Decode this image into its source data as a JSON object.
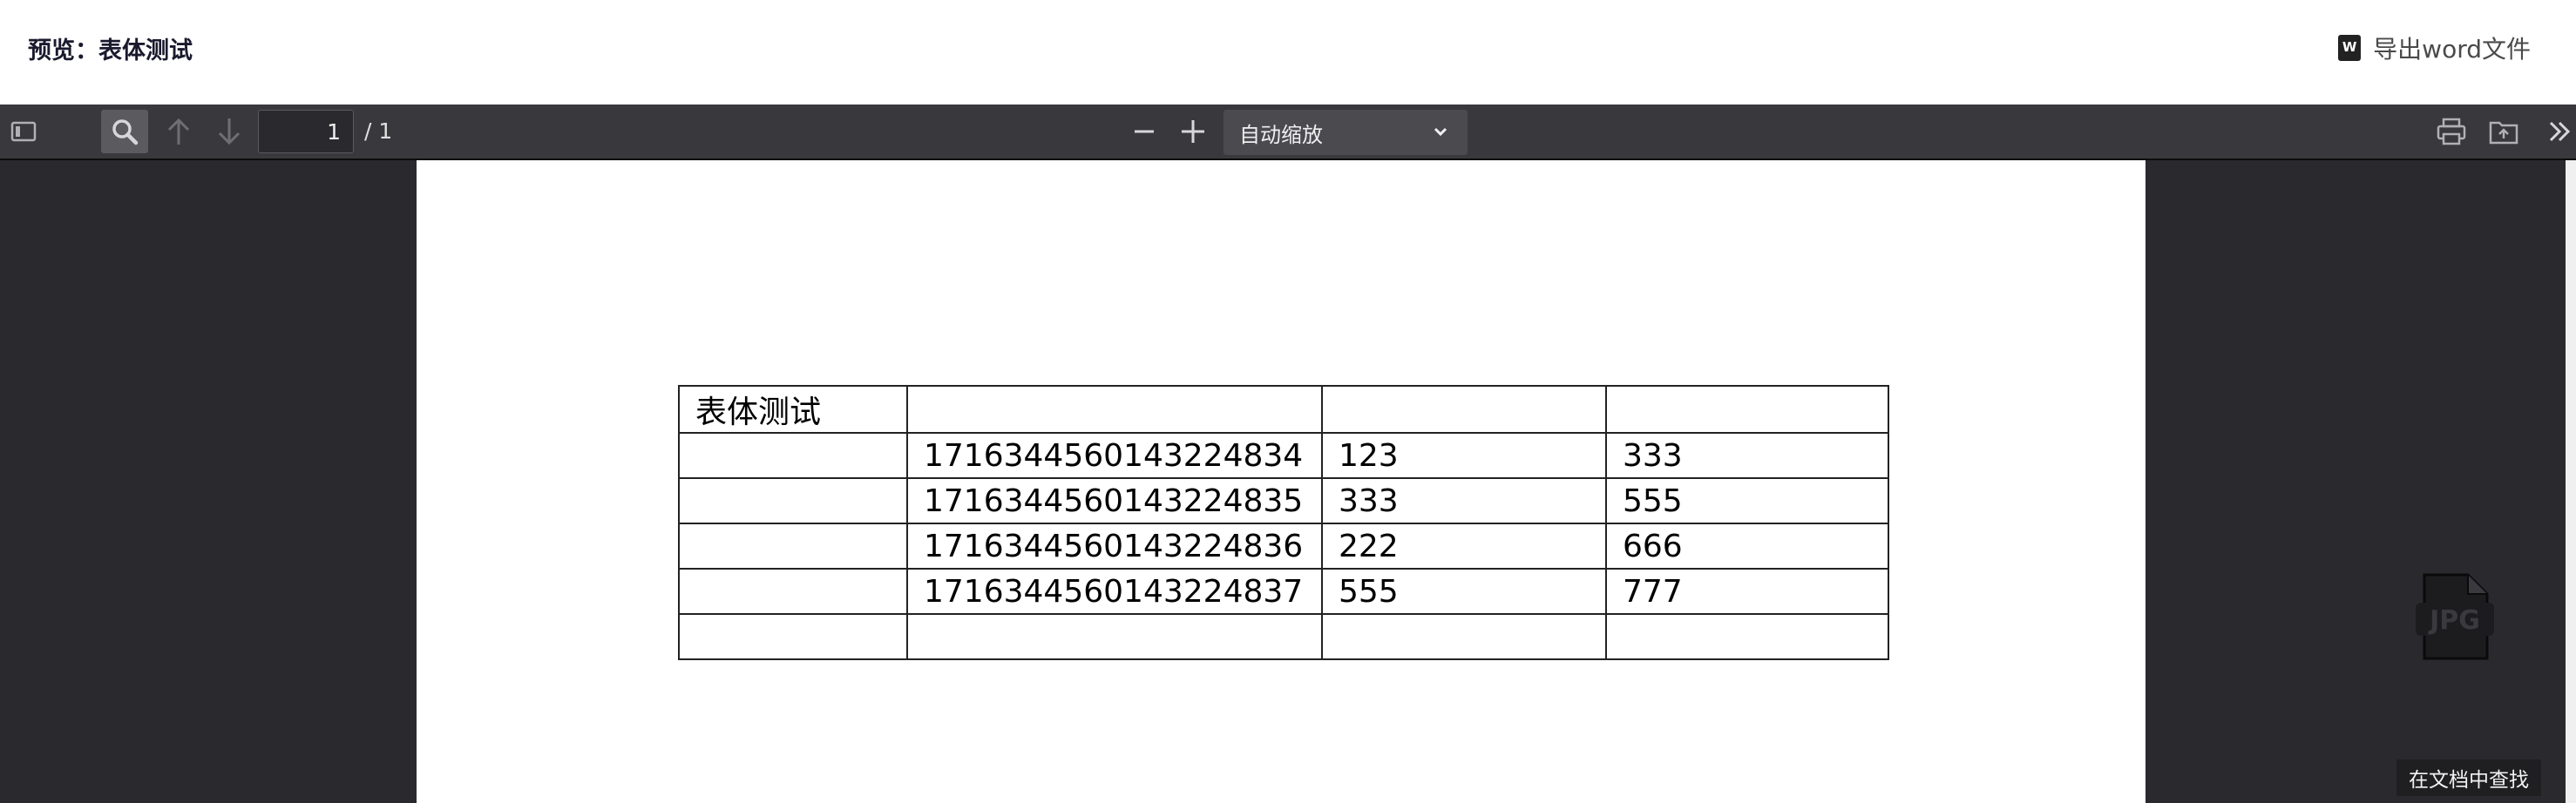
{
  "header": {
    "title": "预览：表体测试",
    "export_label": "导出word文件",
    "export_icon": "word-file-icon"
  },
  "toolbar": {
    "sidebar_icon": "sidebar-toggle-icon",
    "search_icon": "search-icon",
    "prev_icon": "arrow-up-icon",
    "next_icon": "arrow-down-icon",
    "page_number": "1",
    "page_total": "/ 1",
    "zoom_out_icon": "minus-icon",
    "zoom_in_icon": "plus-icon",
    "zoom_value": "自动缩放",
    "print_icon": "print-icon",
    "open_icon": "open-file-icon",
    "tools_icon": "double-chevron-right-icon"
  },
  "document": {
    "table": [
      [
        "表体测试",
        "",
        "",
        ""
      ],
      [
        "",
        "1716344560143224834",
        "123",
        "333"
      ],
      [
        "",
        "1716344560143224835",
        "333",
        "555"
      ],
      [
        "",
        "1716344560143224836",
        "222",
        "666"
      ],
      [
        "",
        "1716344560143224837",
        "555",
        "777"
      ],
      [
        "",
        "",
        "",
        ""
      ]
    ]
  },
  "overlay": {
    "jpg_label": "JPG",
    "find_tooltip": "在文档中查找"
  },
  "colors": {
    "toolbar_bg": "#38383d",
    "viewer_bg": "#2a2a2e",
    "page_bg": "#ffffff"
  }
}
